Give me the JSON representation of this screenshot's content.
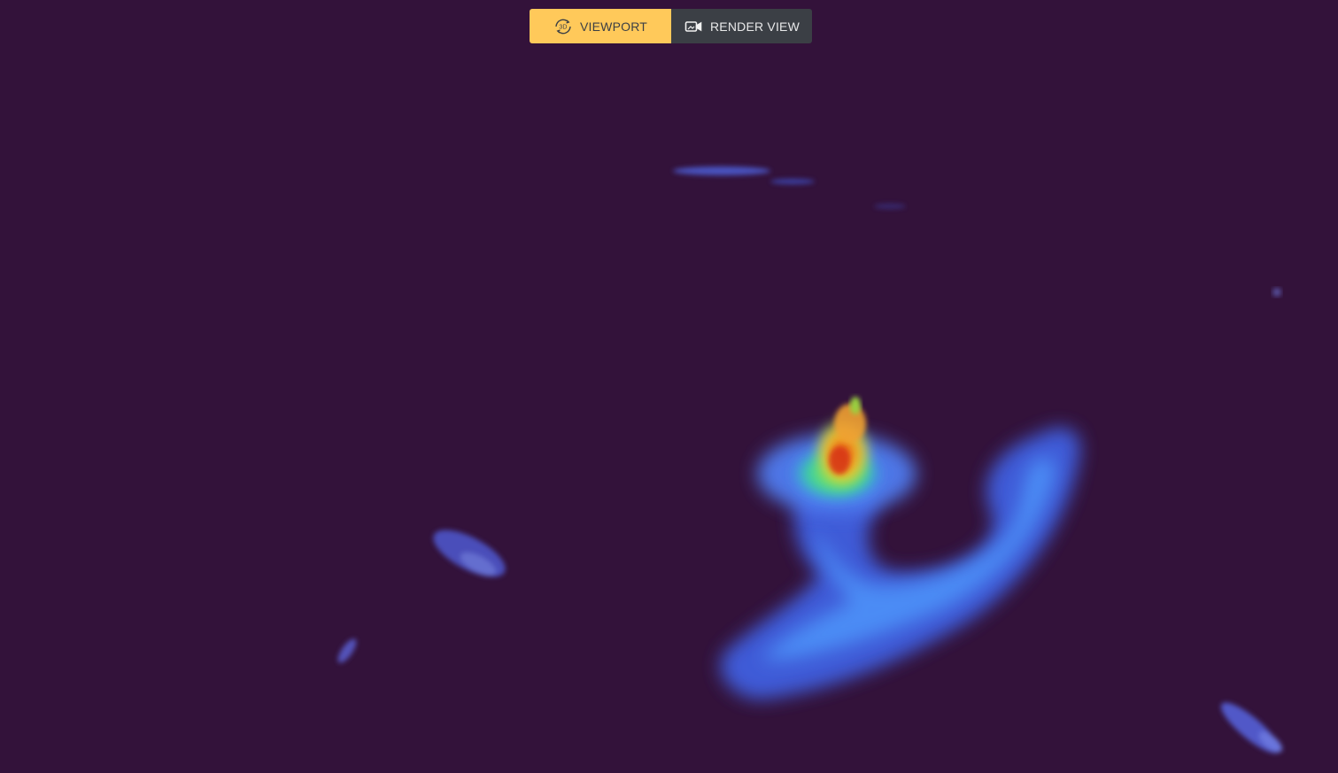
{
  "toolbar": {
    "viewport_label": "VIEWPORT",
    "render_label": "RENDER VIEW",
    "active_mode": "viewport",
    "viewport_icon": "3d-rotate-icon",
    "render_icon": "video-camera-icon"
  },
  "colors": {
    "background": "#33123a",
    "active_button": "#ffc95a",
    "inactive_button": "#3b3f45",
    "heatmap_low": "#3a4fd6",
    "heatmap_mid": "#49a7ff",
    "heatmap_high": "#f0c030",
    "heatmap_peak": "#e0401a"
  }
}
